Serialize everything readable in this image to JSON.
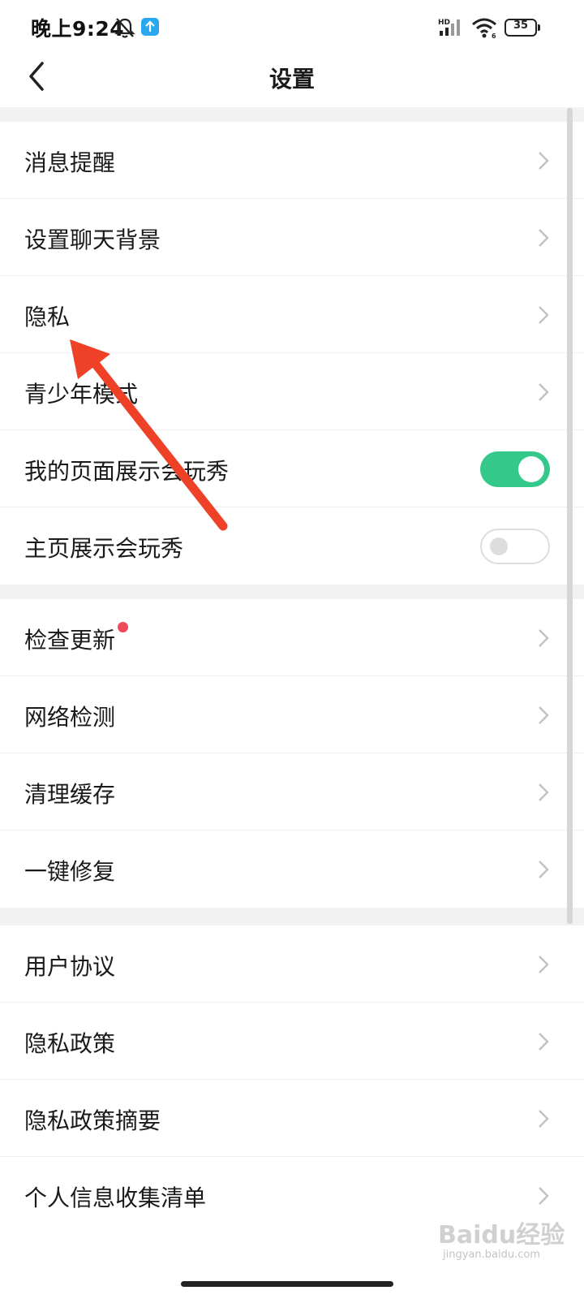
{
  "status_bar": {
    "time": "晚上9:24",
    "battery": "35",
    "icons": [
      "bell-muted-icon",
      "app-notification-icon",
      "signal-hd-icon",
      "wifi-icon",
      "battery-icon"
    ]
  },
  "header": {
    "title": "设置",
    "back_icon": "chevron-left-icon"
  },
  "groups": [
    {
      "items": [
        {
          "label": "消息提醒",
          "type": "link"
        },
        {
          "label": "设置聊天背景",
          "type": "link"
        },
        {
          "label": "隐私",
          "type": "link"
        },
        {
          "label": "青少年模式",
          "type": "link"
        },
        {
          "label": "我的页面展示会玩秀",
          "type": "toggle",
          "on": true
        },
        {
          "label": "主页展示会玩秀",
          "type": "toggle",
          "on": false
        }
      ]
    },
    {
      "items": [
        {
          "label": "检查更新",
          "type": "link",
          "badge": "red-dot"
        },
        {
          "label": "网络检测",
          "type": "link"
        },
        {
          "label": "清理缓存",
          "type": "link"
        },
        {
          "label": "一键修复",
          "type": "link"
        }
      ]
    },
    {
      "items": [
        {
          "label": "用户协议",
          "type": "link"
        },
        {
          "label": "隐私政策",
          "type": "link"
        },
        {
          "label": "隐私政策摘要",
          "type": "link"
        },
        {
          "label": "个人信息收集清单",
          "type": "link"
        }
      ]
    }
  ],
  "colors": {
    "toggle_on": "#34c98a",
    "badge": "#f04a5a",
    "annotation_arrow": "#ee4128",
    "section_gap": "#f2f2f2"
  },
  "annotation": {
    "icon": "red-arrow-pointing-to-privacy"
  },
  "watermark": {
    "main": "Baidu经验",
    "sub": "jingyan.baidu.com"
  }
}
